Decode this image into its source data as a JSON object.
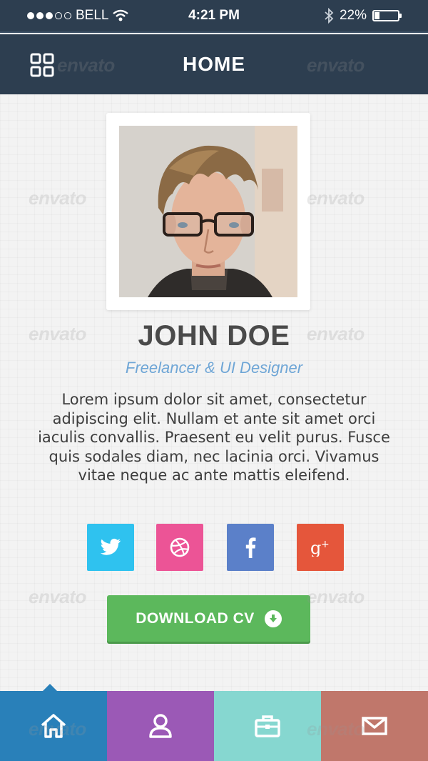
{
  "status_bar": {
    "carrier": "BELL",
    "time": "4:21 PM",
    "battery": "22%",
    "battery_level": 0.22
  },
  "nav": {
    "title": "HOME",
    "menu_icon": "grid-icon"
  },
  "profile": {
    "name": "JOHN DOE",
    "role": "Freelancer & UI Designer",
    "bio": "Lorem ipsum dolor sit amet, consectetur adipiscing elit. Nullam et ante sit amet orci iaculis convallis. Praesent eu velit purus. Fusce quis sodales diam, nec lacinia orci. Vivamus vitae neque ac ante mattis eleifend."
  },
  "social": [
    {
      "name": "twitter",
      "icon": "twitter-icon",
      "color": "#2fc2ef"
    },
    {
      "name": "dribbble",
      "icon": "dribbble-icon",
      "color": "#ec5496"
    },
    {
      "name": "facebook",
      "icon": "facebook-icon",
      "color": "#5b80c9"
    },
    {
      "name": "google-plus",
      "icon": "google-plus-icon",
      "color": "#e5563b"
    }
  ],
  "download_button": {
    "label": "DOWNLOAD CV",
    "color": "#5cb85c"
  },
  "tabbar": [
    {
      "icon": "home-icon",
      "color": "#2980b9",
      "active": true
    },
    {
      "icon": "user-icon",
      "color": "#9b59b6",
      "active": false
    },
    {
      "icon": "briefcase-icon",
      "color": "#86d7d0",
      "active": false
    },
    {
      "icon": "mail-icon",
      "color": "#c0776b",
      "active": false
    }
  ],
  "watermark": "envato"
}
